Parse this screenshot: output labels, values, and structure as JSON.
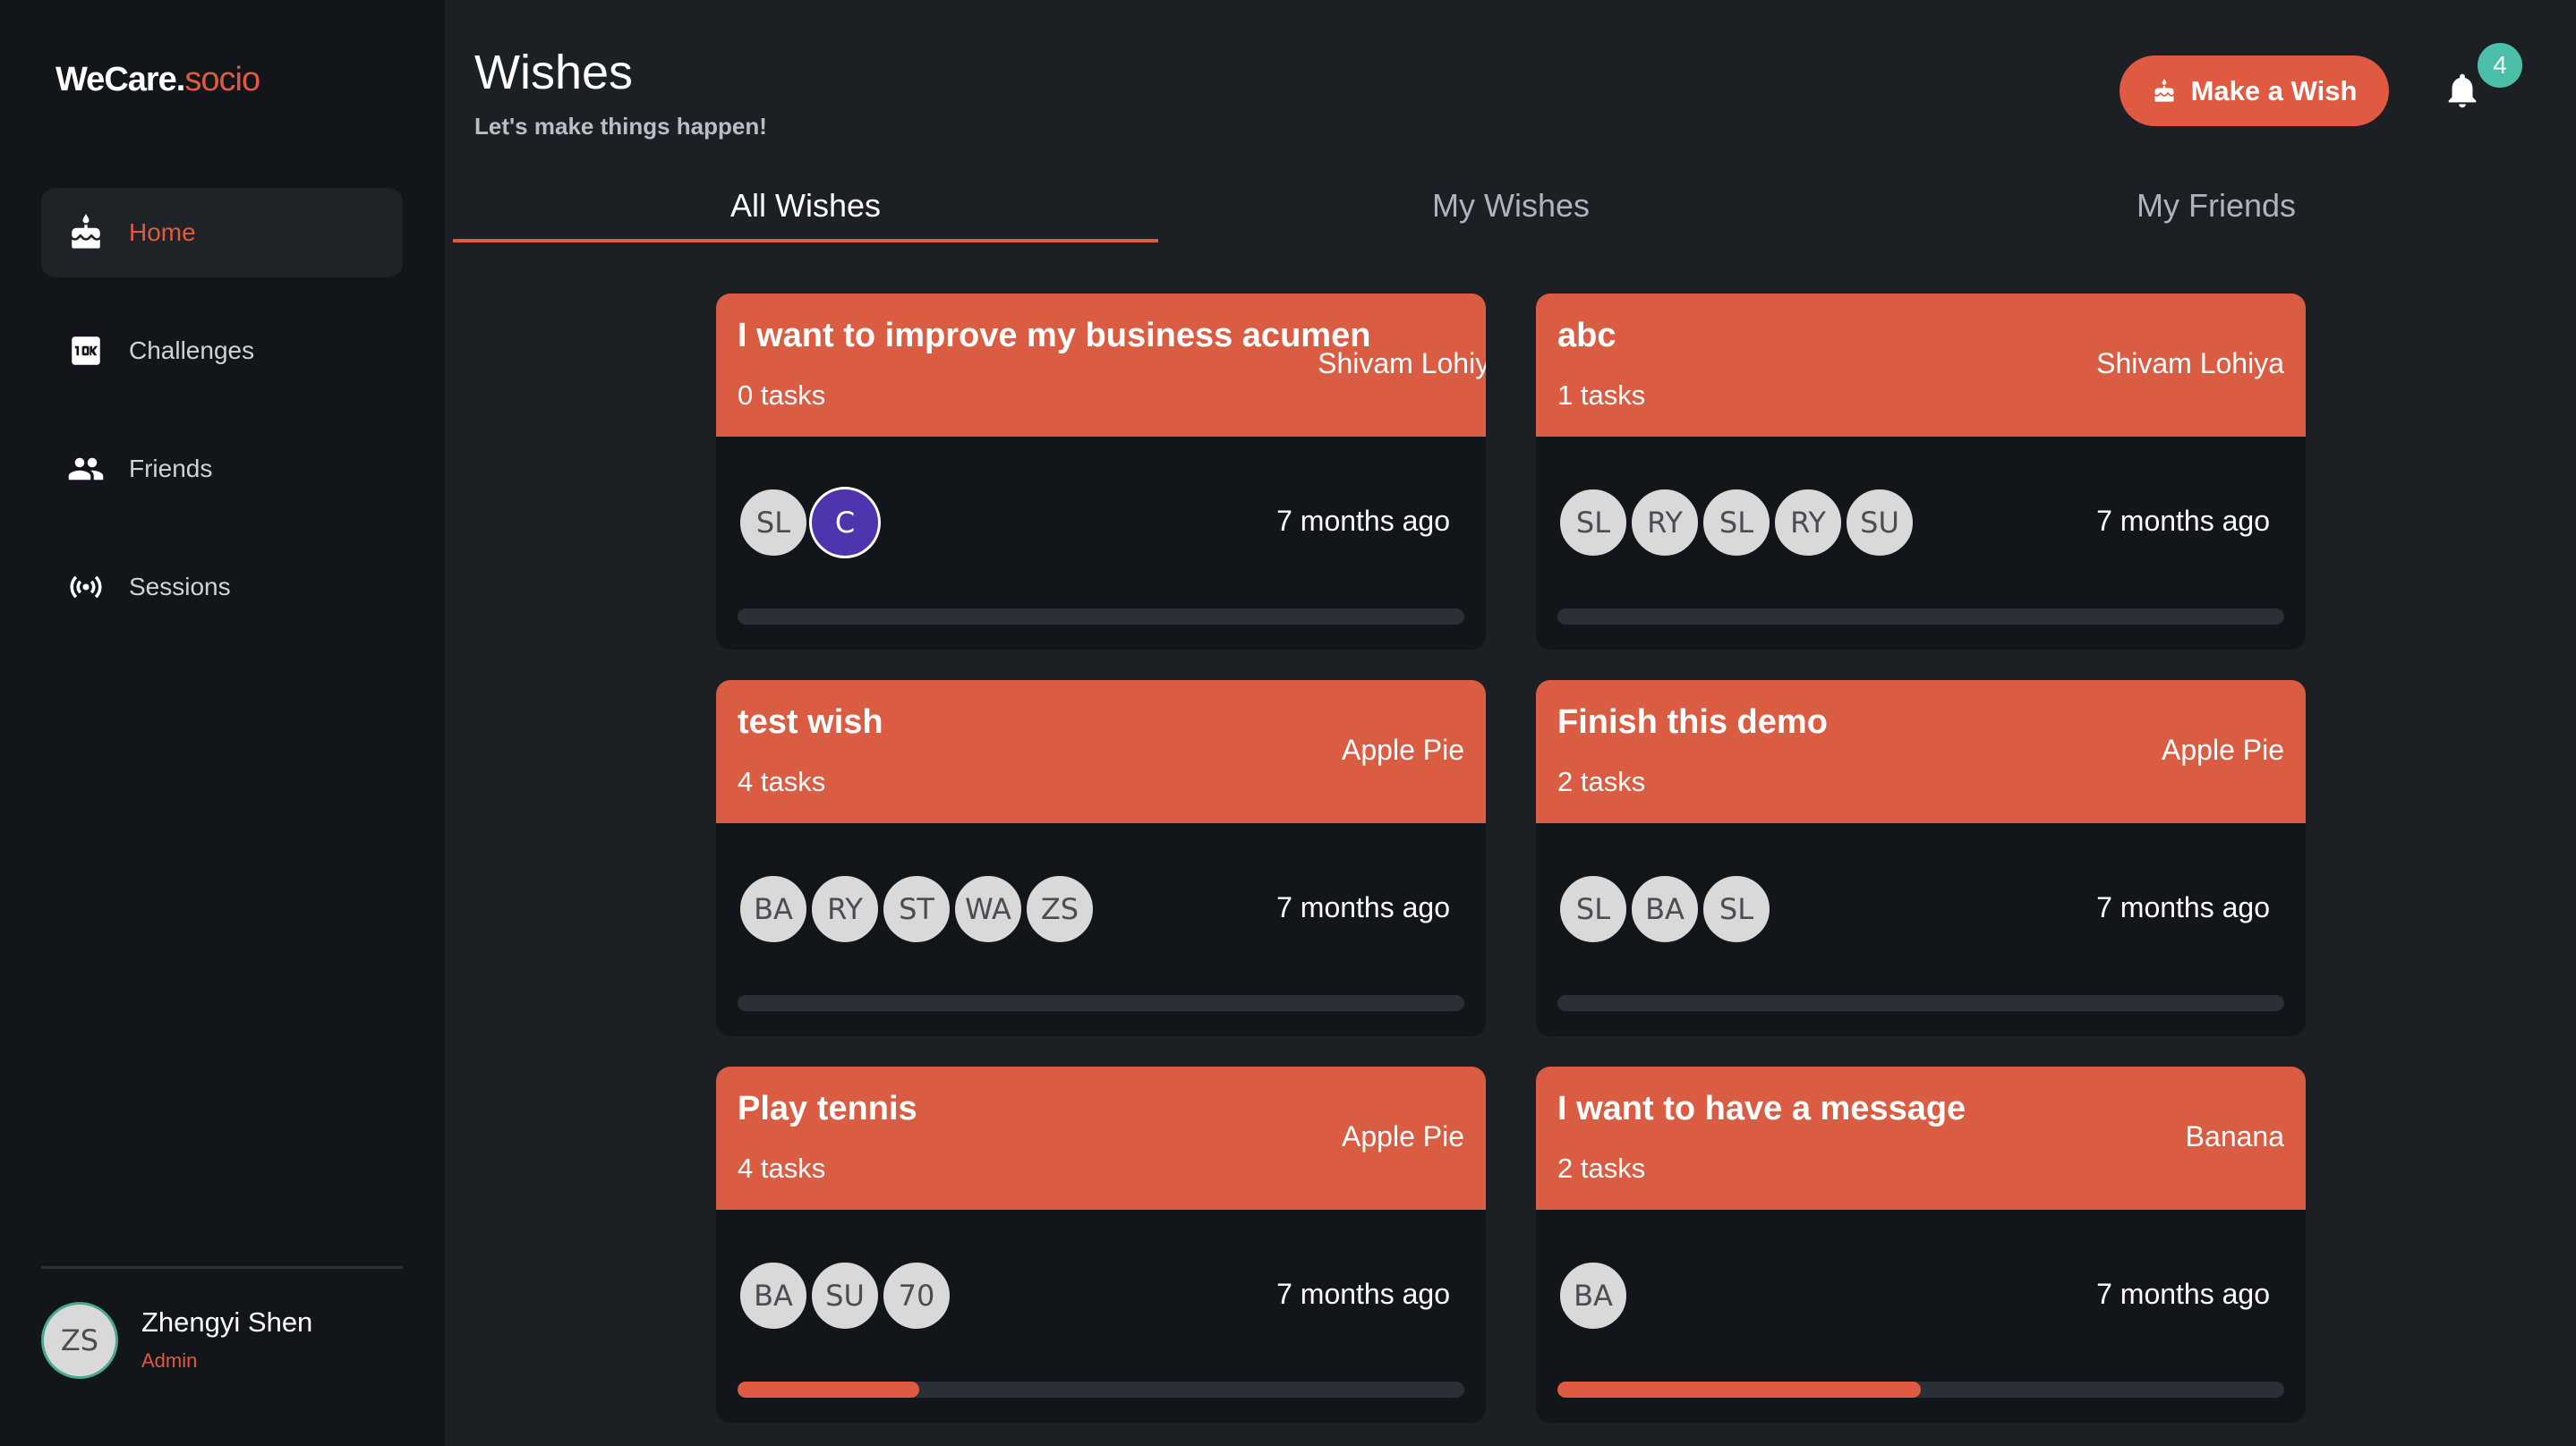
{
  "brand": {
    "name": "WeCare.",
    "suffix": "socio",
    "accent_color": "#e05a41"
  },
  "sidebar": {
    "items": [
      {
        "label": "Home",
        "icon": "cake-icon",
        "active": true
      },
      {
        "label": "Challenges",
        "icon": "10k-icon",
        "active": false
      },
      {
        "label": "Friends",
        "icon": "people-icon",
        "active": false
      },
      {
        "label": "Sessions",
        "icon": "broadcast-icon",
        "active": false
      }
    ],
    "user": {
      "initials": "ZS",
      "name": "Zhengyi Shen",
      "role": "Admin"
    }
  },
  "header": {
    "title": "Wishes",
    "subtitle": "Let's make things happen!",
    "action_label": "Make a Wish",
    "notification_count": "4"
  },
  "tabs": [
    {
      "label": "All Wishes",
      "active": true
    },
    {
      "label": "My Wishes",
      "active": false
    },
    {
      "label": "My Friends",
      "active": false
    }
  ],
  "wishes": [
    {
      "title": "I want to improve my business acumen",
      "tasks": "0 tasks",
      "owner": "Shivam Lohiya",
      "members": [
        "SL",
        "C"
      ],
      "time": "7 months ago",
      "progress": 0
    },
    {
      "title": "abc",
      "tasks": "1 tasks",
      "owner": "Shivam Lohiya",
      "members": [
        "SL",
        "RY",
        "SL",
        "RY",
        "SU"
      ],
      "time": "7 months ago",
      "progress": 0
    },
    {
      "title": "test wish",
      "tasks": "4 tasks",
      "owner": "Apple Pie",
      "members": [
        "BA",
        "RY",
        "ST",
        "WA",
        "ZS"
      ],
      "time": "7 months ago",
      "progress": 0
    },
    {
      "title": "Finish this demo",
      "tasks": "2 tasks",
      "owner": "Apple Pie",
      "members": [
        "SL",
        "BA",
        "SL"
      ],
      "time": "7 months ago",
      "progress": 0
    },
    {
      "title": "Play tennis",
      "tasks": "4 tasks",
      "owner": "Apple Pie",
      "members": [
        "BA",
        "SU",
        "70"
      ],
      "time": "7 months ago",
      "progress": 0.25
    },
    {
      "title": "I want to have a message",
      "tasks": "2 tasks",
      "owner": "Banana",
      "members": [
        "BA"
      ],
      "time": "7 months ago",
      "progress": 0.5
    }
  ]
}
